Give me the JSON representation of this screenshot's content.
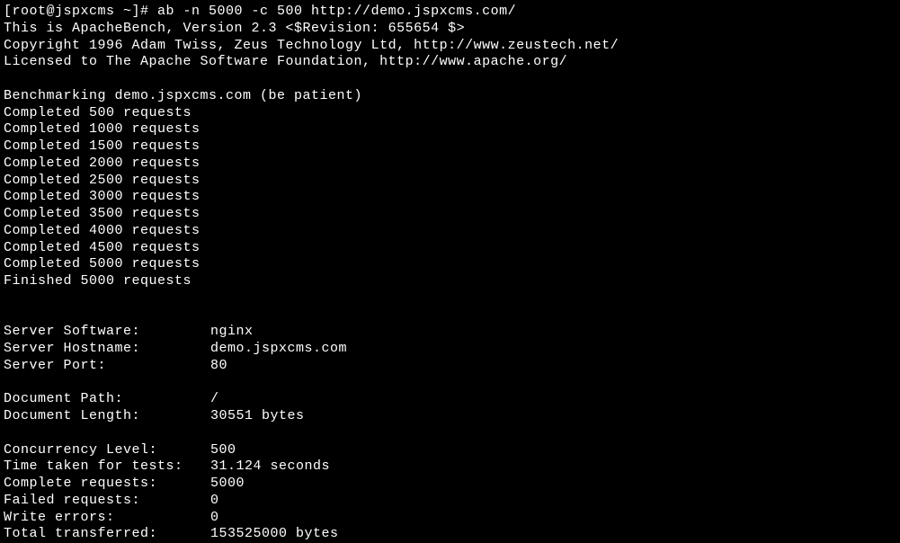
{
  "prompt": "[root@jspxcms ~]# ab -n 5000 -c 500 http://demo.jspxcms.com/",
  "header": {
    "line1": "This is ApacheBench, Version 2.3 <$Revision: 655654 $>",
    "line2": "Copyright 1996 Adam Twiss, Zeus Technology Ltd, http://www.zeustech.net/",
    "line3": "Licensed to The Apache Software Foundation, http://www.apache.org/"
  },
  "benchmarking": "Benchmarking demo.jspxcms.com (be patient)",
  "progress": [
    "Completed 500 requests",
    "Completed 1000 requests",
    "Completed 1500 requests",
    "Completed 2000 requests",
    "Completed 2500 requests",
    "Completed 3000 requests",
    "Completed 3500 requests",
    "Completed 4000 requests",
    "Completed 4500 requests",
    "Completed 5000 requests"
  ],
  "finished": "Finished 5000 requests",
  "server": {
    "software_label": "Server Software:",
    "software_value": "nginx",
    "hostname_label": "Server Hostname:",
    "hostname_value": "demo.jspxcms.com",
    "port_label": "Server Port:",
    "port_value": "80"
  },
  "document": {
    "path_label": "Document Path:",
    "path_value": "/",
    "length_label": "Document Length:",
    "length_value": "30551 bytes"
  },
  "results": {
    "concurrency_label": "Concurrency Level:",
    "concurrency_value": "500",
    "time_label": "Time taken for tests:",
    "time_value": "31.124 seconds",
    "complete_label": "Complete requests:",
    "complete_value": "5000",
    "failed_label": "Failed requests:",
    "failed_value": "0",
    "write_errors_label": "Write errors:",
    "write_errors_value": "0",
    "total_transferred_label": "Total transferred:",
    "total_transferred_value": "153525000 bytes"
  }
}
